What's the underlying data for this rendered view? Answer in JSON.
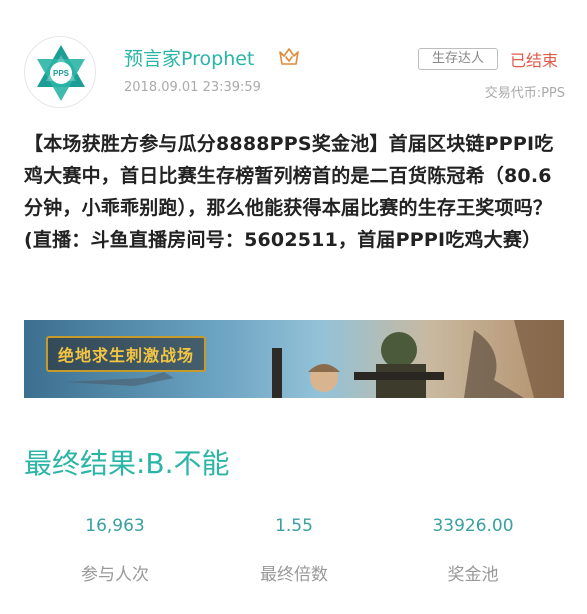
{
  "post": {
    "username": "预言家Prophet",
    "timestamp": "2018.09.01 23:39:59",
    "tag": "生存达人",
    "status": "已结束",
    "currency": "交易代币:PPS",
    "question": "【本场获胜方参与瓜分8888PPS奖金池】首届区块链PPPI吃鸡大赛中，首日比赛生存榜暂列榜首的是二百货陈冠希（80.6分钟，小乖乖别跑），那么他能获得本届比赛的生存王奖项吗？(直播：斗鱼直播房间号：5602511，首届PPPI吃鸡大赛）",
    "banner_text": "绝地求生刺激战场",
    "avatar_text": "PPS",
    "result": "最终结果:B.不能"
  },
  "stats": [
    {
      "value": "16,963",
      "label": "参与人次"
    },
    {
      "value": "1.55",
      "label": "最终倍数"
    },
    {
      "value": "33926.00",
      "label": "奖金池"
    }
  ],
  "colors": {
    "accent": "#2bb5a6",
    "status": "#e05a4a",
    "stat_value": "#3aa0a0"
  }
}
